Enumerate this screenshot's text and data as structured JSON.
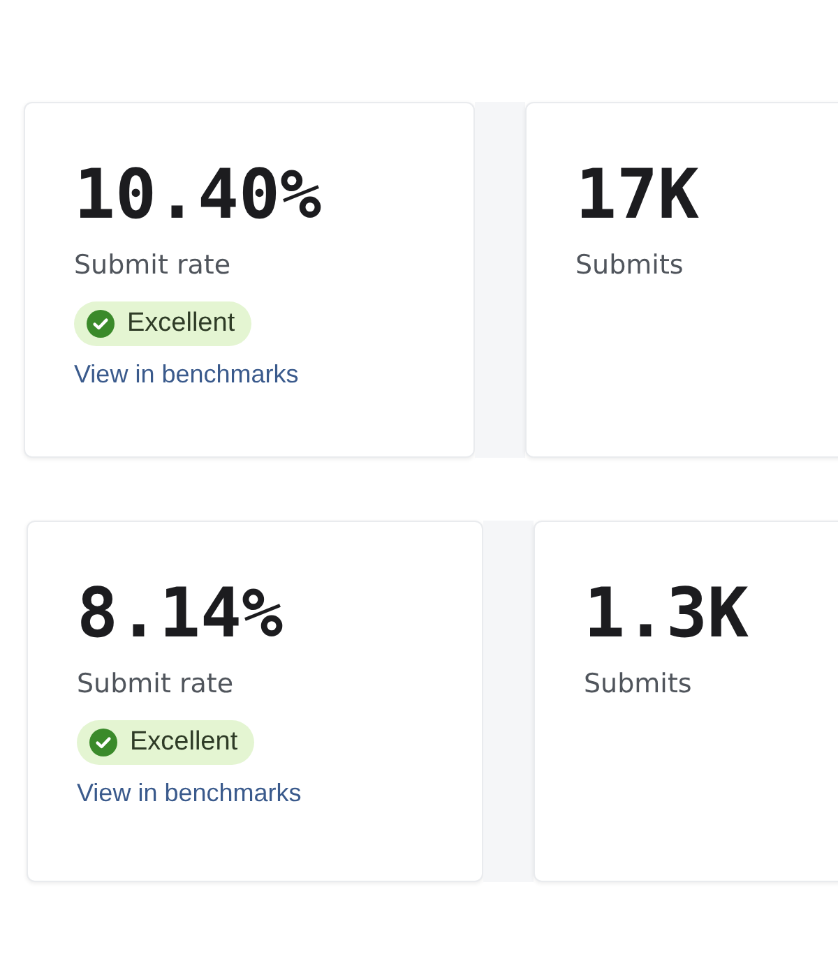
{
  "rows": [
    {
      "cards": [
        {
          "value": "10.40%",
          "label": "Submit rate",
          "badge": "Excellent",
          "link": "View in benchmarks"
        },
        {
          "value": "17K",
          "label": "Submits"
        }
      ]
    },
    {
      "cards": [
        {
          "value": "8.14%",
          "label": "Submit rate",
          "badge": "Excellent",
          "link": "View in benchmarks"
        },
        {
          "value": "1.3K",
          "label": "Submits"
        }
      ]
    }
  ]
}
